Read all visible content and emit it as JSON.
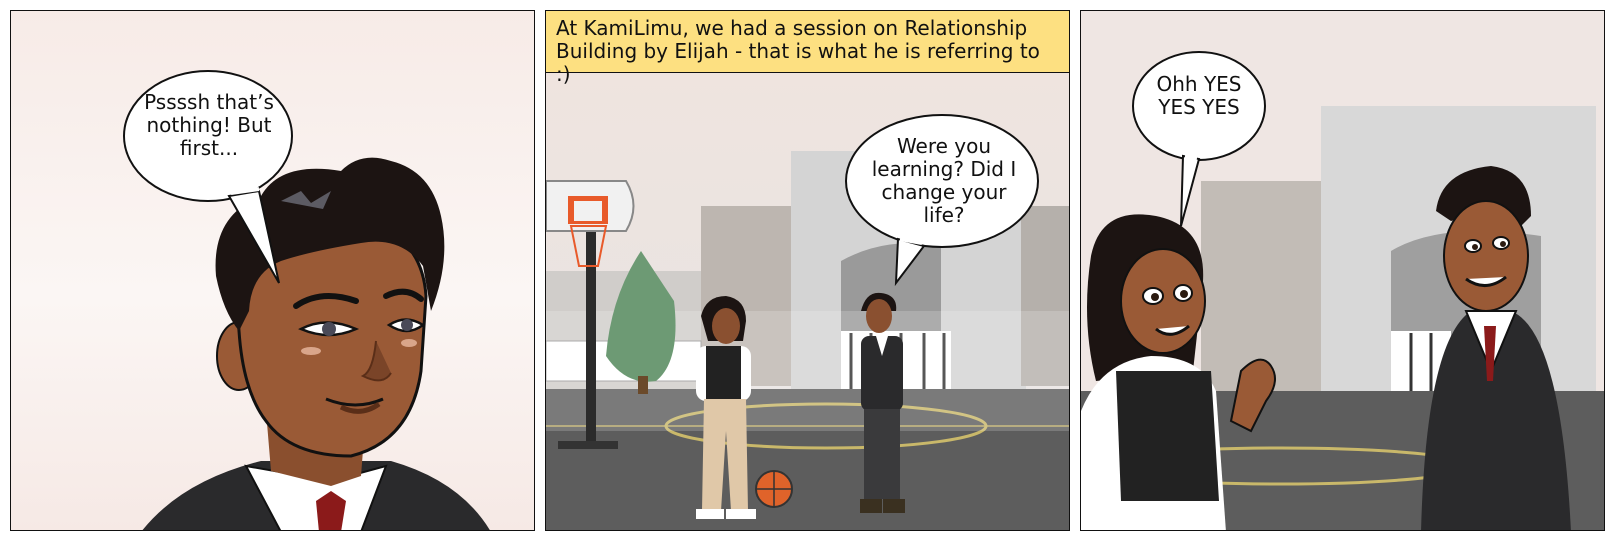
{
  "panels": [
    {
      "bubble": "Pssssh that’s nothing! But first..."
    },
    {
      "caption": "At KamiLimu, we had a session on Relationship Building by Elijah - that is what he is referring to :)",
      "bubble": "Were you learning? Did I change your life?"
    },
    {
      "bubble": "Ohh YES YES YES"
    }
  ],
  "colors": {
    "caption_bg": "#fde081",
    "skin": "#9a5a36",
    "hair": "#1c1412",
    "suit": "#2a2a2c",
    "tie": "#8b1a1a"
  }
}
